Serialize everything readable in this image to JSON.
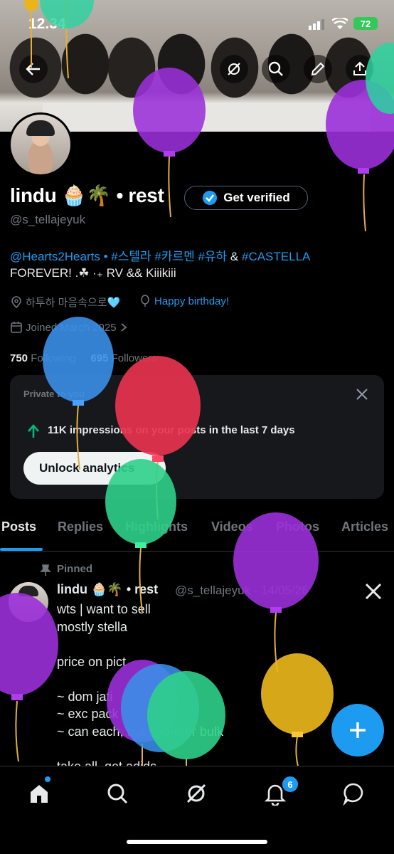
{
  "status_bar": {
    "time": "12.34",
    "battery": "72"
  },
  "profile": {
    "name": "lindu 🧁🌴 • rest",
    "verify_label": "Get verified",
    "handle": "@s_tellajeyuk",
    "bio_link": "@Hearts2Hearts",
    "bio_tags": " • #스텔라 #카르멘 #유하",
    "bio_amp": " & ",
    "bio_castella": "#CASTELLA",
    "bio_line2": "FOREVER! .☘ ·₊ RV && Kiiikiii",
    "location": "하투하 마음속으로🩵",
    "birthday": "Happy birthday!",
    "joined": "Joined March 2025",
    "following_count": "750",
    "following_label": "Following",
    "followers_count": "695",
    "followers_label": "Followers"
  },
  "analytics_card": {
    "private_label": "Private to you",
    "impressions_text": "11K impressions on your posts in the last 7 days",
    "unlock_label": "Unlock analytics"
  },
  "tabs": [
    "Posts",
    "Replies",
    "Highlights",
    "Videos",
    "Photos",
    "Articles"
  ],
  "pinned_post": {
    "pinned_label": "Pinned",
    "author": "lindu 🧁🌴 • rest",
    "handle_date": "@s_tellajeyuk · 14/05/26",
    "text": "wts | want to sell\nmostly stella\n\nprice on pict\n\n~ dom jati\n~ exc pack\n~ can each, but i'll prefer bulk\n\ntake all, get adids"
  },
  "bottom_nav": {
    "notifications_badge": "6"
  },
  "colors": {
    "accent": "#1d9bf0",
    "background": "#000000",
    "card": "#16181c",
    "muted": "#71767b"
  },
  "balloon_colors": [
    "#9b30d9",
    "#3a8fe8",
    "#e8334f",
    "#2fd08a",
    "#e9b51c",
    "#2bd3a0"
  ]
}
